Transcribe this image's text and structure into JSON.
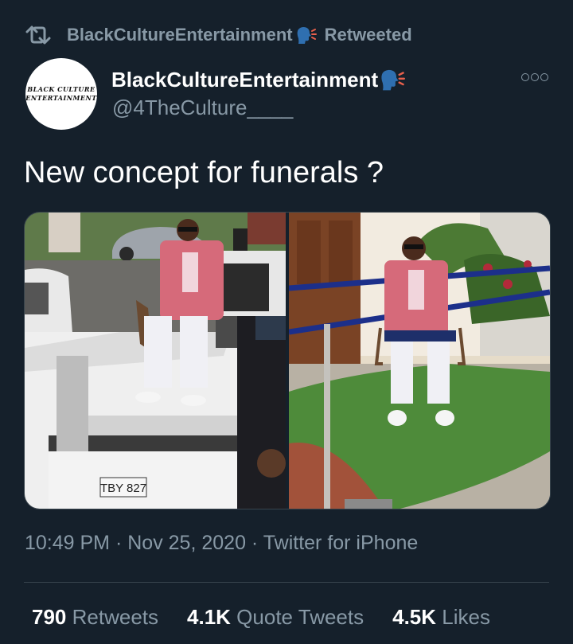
{
  "retweet": {
    "retweeter": "BlackCultureEntertainment",
    "label": "Retweeted"
  },
  "author": {
    "display_name": "BlackCultureEntertainment",
    "handle": "@4TheCulture____",
    "avatar_text_line1": "BLACK CULTURE",
    "avatar_text_line2": "ENTERTAINMENT"
  },
  "tweet": {
    "text": "New concept for funerals ?",
    "time": "10:49 PM",
    "date": "Nov 25, 2020",
    "source": "Twitter for iPhone",
    "separator": "·"
  },
  "media": {
    "left_photo": {
      "plate": "TBY 827"
    },
    "right_photo": {}
  },
  "stats": {
    "retweets": {
      "count": "790",
      "label": "Retweets"
    },
    "quote_tweets": {
      "count": "4.1K",
      "label": "Quote Tweets"
    },
    "likes": {
      "count": "4.5K",
      "label": "Likes"
    }
  },
  "colors": {
    "background": "#15202b",
    "secondary_text": "#8899a6",
    "divider": "#38444d",
    "speaking_emoji": "#2f6fb0"
  },
  "icons": [
    "retweet-icon",
    "speaking-head-emoji",
    "more-options-icon"
  ]
}
